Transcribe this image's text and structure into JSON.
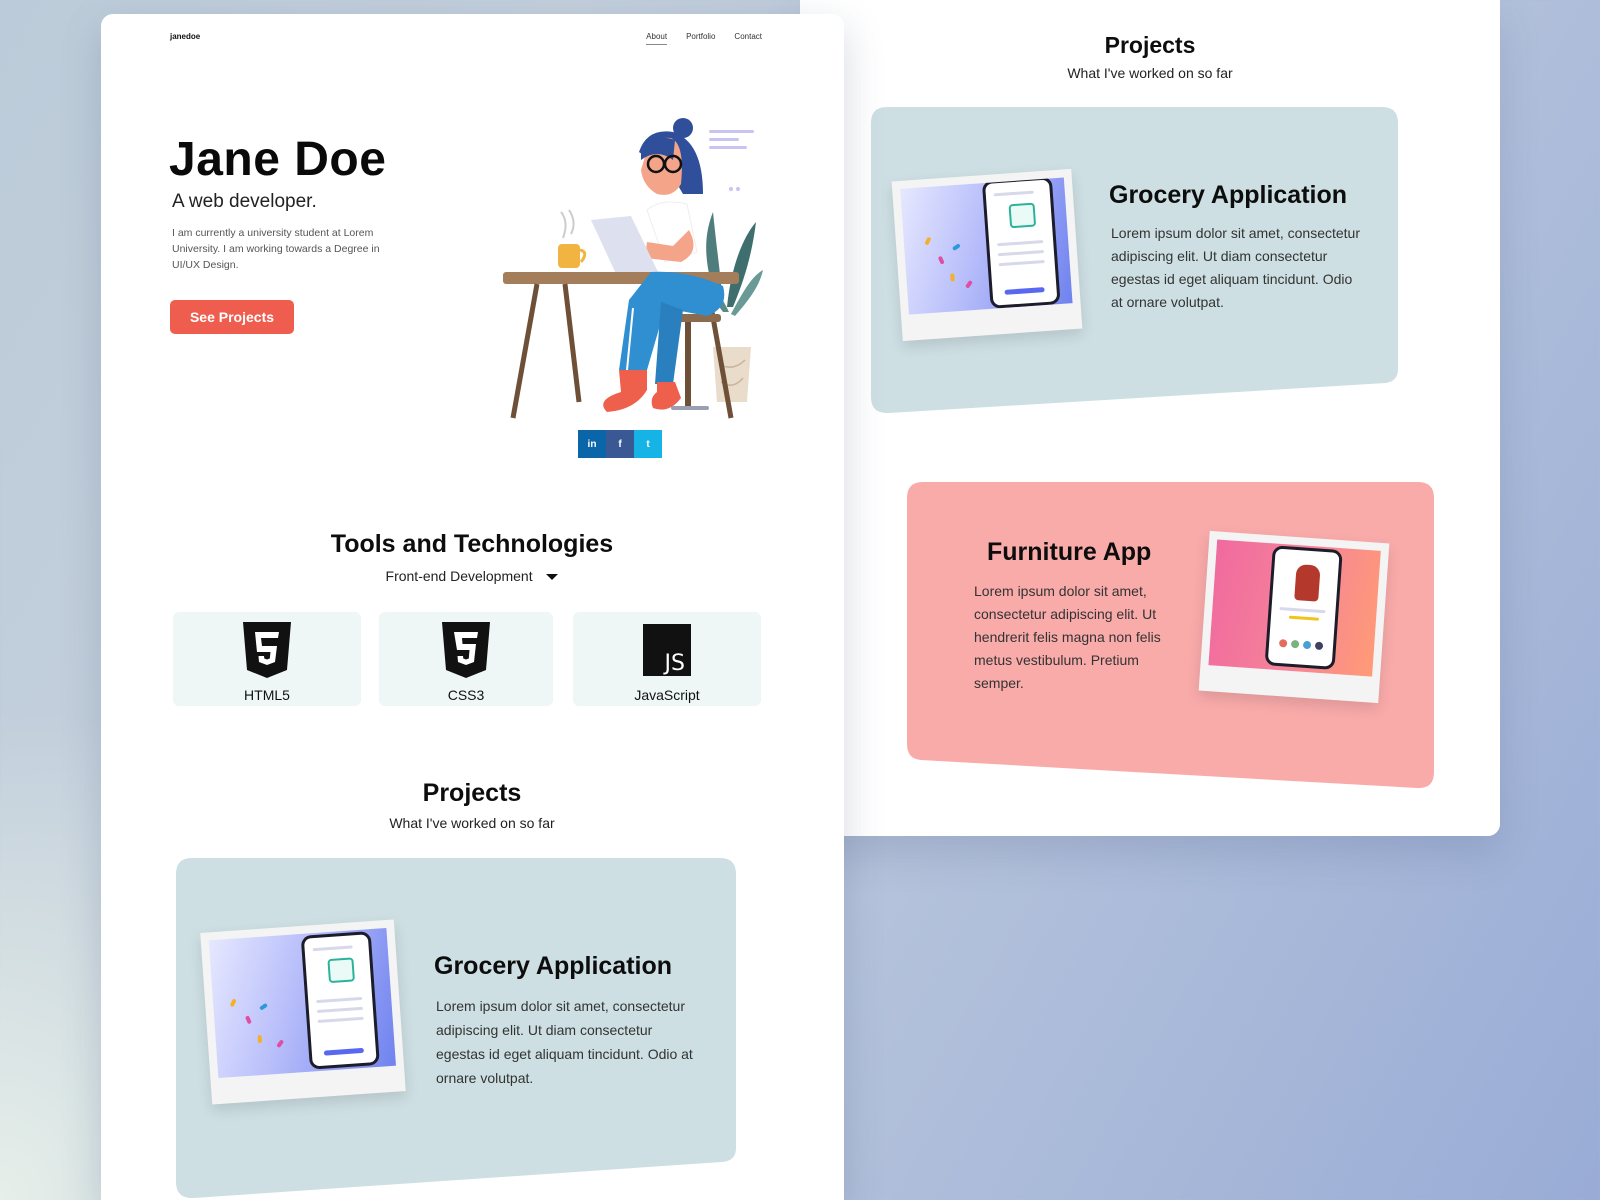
{
  "colors": {
    "accent": "#ef5d4f",
    "card_blue": "#cddfe3",
    "card_pink": "#f9abaa",
    "tool_bg": "#eef7f6",
    "linkedin": "#0a66a8",
    "facebook": "#3a5894",
    "twitter": "#15b3e6"
  },
  "left_page": {
    "logo": "janedoe",
    "nav": {
      "about": "About",
      "portfolio": "Portfolio",
      "contact": "Contact",
      "active": "About"
    },
    "hero": {
      "name": "Jane Doe",
      "role": "A web developer.",
      "intro": "I am currently a university student at  Lorem University. I am working towards a Degree in UI/UX Design.",
      "cta": "See Projects"
    },
    "social": [
      {
        "icon": "linkedin-icon",
        "glyph": "in"
      },
      {
        "icon": "facebook-icon",
        "glyph": "f"
      },
      {
        "icon": "twitter-icon",
        "glyph": "t"
      }
    ],
    "tools": {
      "title": "Tools and Technologies",
      "filter": "Front-end Development",
      "items": [
        {
          "label": "HTML5",
          "icon": "html5-icon"
        },
        {
          "label": "CSS3",
          "icon": "css3-icon"
        },
        {
          "label": "JavaScript",
          "icon": "javascript-icon"
        }
      ]
    },
    "projects": {
      "title": "Projects",
      "subtitle": "What I've worked on so far",
      "items": [
        {
          "title": "Grocery Application",
          "desc": "Lorem ipsum dolor sit amet, consectetur adipiscing elit. Ut diam consectetur egestas id eget aliquam tincidunt. Odio at ornare volutpat."
        }
      ]
    }
  },
  "right_page": {
    "projects": {
      "title": "Projects",
      "subtitle": "What I've worked on so far",
      "items": [
        {
          "title": "Grocery Application",
          "desc": "Lorem ipsum dolor sit amet, consectetur adipiscing elit. Ut diam consectetur egestas id eget aliquam tincidunt. Odio at ornare volutpat."
        },
        {
          "title": "Furniture App",
          "desc": "Lorem ipsum dolor sit amet, consectetur adipiscing elit. Ut hendrerit felis magna non felis metus vestibulum. Pretium semper."
        }
      ]
    }
  }
}
